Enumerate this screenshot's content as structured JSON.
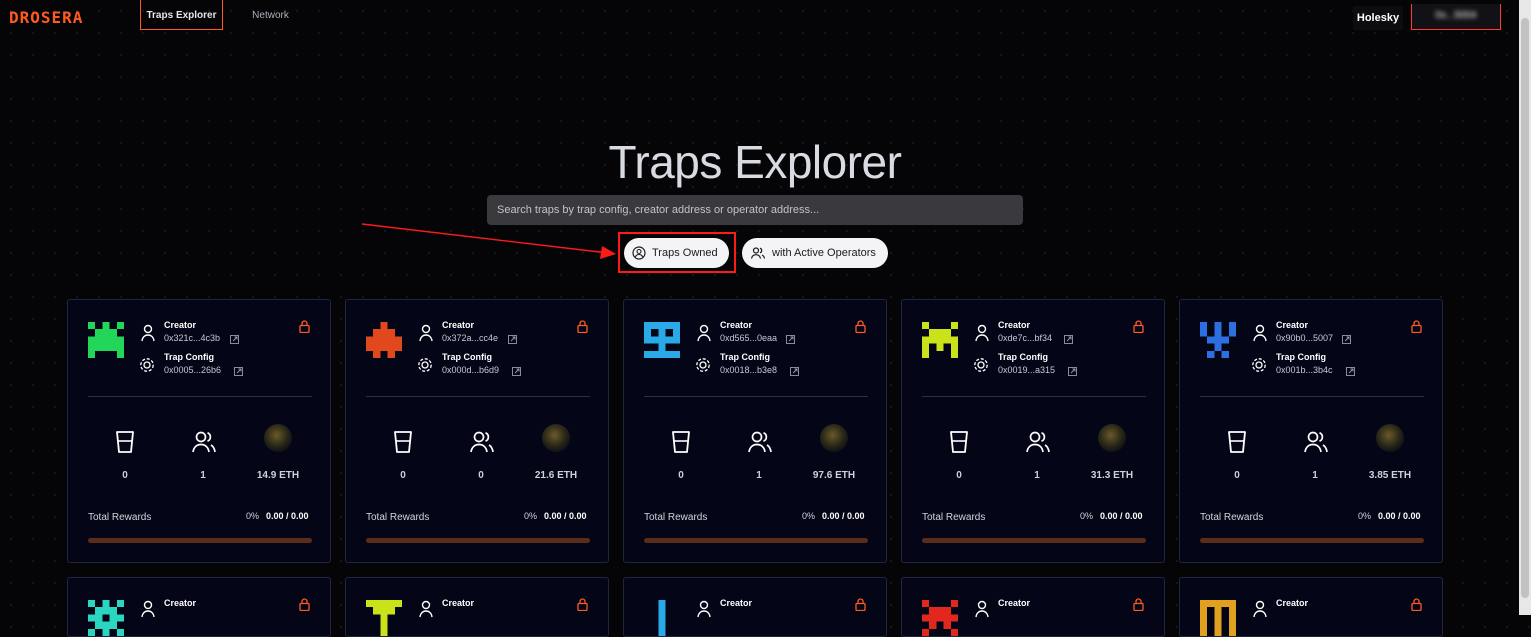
{
  "app": {
    "logo": "DROSERA"
  },
  "nav": {
    "tabs": [
      {
        "label": "Traps Explorer",
        "active": true
      },
      {
        "label": "Network",
        "active": false
      }
    ]
  },
  "header": {
    "network": "Holesky",
    "wallet": "0x...5004"
  },
  "page": {
    "title": "Traps Explorer"
  },
  "search": {
    "placeholder": "Search traps by trap config, creator address or operator address..."
  },
  "filters": {
    "owned": "Traps Owned",
    "active_operators": "with Active Operators"
  },
  "labels": {
    "creator": "Creator",
    "trap_config": "Trap Config",
    "total_rewards": "Total Rewards"
  },
  "colors": {
    "accent": "#ff5a1f",
    "highlight": "#ff1a1a"
  },
  "cards": [
    {
      "color": "#22d65a",
      "creator": "0x321c...4c3b",
      "trap_config": "0x0005...26b6",
      "responses": "0",
      "operators": "1",
      "eth": "14.9 ETH",
      "pct": "0%",
      "rewards": "0.00 / 0.00"
    },
    {
      "color": "#e2481e",
      "creator": "0x372a...cc4e",
      "trap_config": "0x000d...b6d9",
      "responses": "0",
      "operators": "0",
      "eth": "21.6 ETH",
      "pct": "0%",
      "rewards": "0.00 / 0.00"
    },
    {
      "color": "#2aa9e8",
      "creator": "0xd565...0eaa",
      "trap_config": "0x0018...b3e8",
      "responses": "0",
      "operators": "1",
      "eth": "97.6 ETH",
      "pct": "0%",
      "rewards": "0.00 / 0.00"
    },
    {
      "color": "#c9e21a",
      "creator": "0xde7c...bf34",
      "trap_config": "0x0019...a315",
      "responses": "0",
      "operators": "1",
      "eth": "31.3 ETH",
      "pct": "0%",
      "rewards": "0.00 / 0.00"
    },
    {
      "color": "#2c6fe0",
      "creator": "0x90b0...5007",
      "trap_config": "0x001b...3b4c",
      "responses": "0",
      "operators": "1",
      "eth": "3.85 ETH",
      "pct": "0%",
      "rewards": "0.00 / 0.00"
    }
  ],
  "cards_row2": [
    {
      "color": "#2ad6c0"
    },
    {
      "color": "#c9e21a"
    },
    {
      "color": "#2aa9e8"
    },
    {
      "color": "#e2281e"
    },
    {
      "color": "#e0a21e"
    }
  ]
}
